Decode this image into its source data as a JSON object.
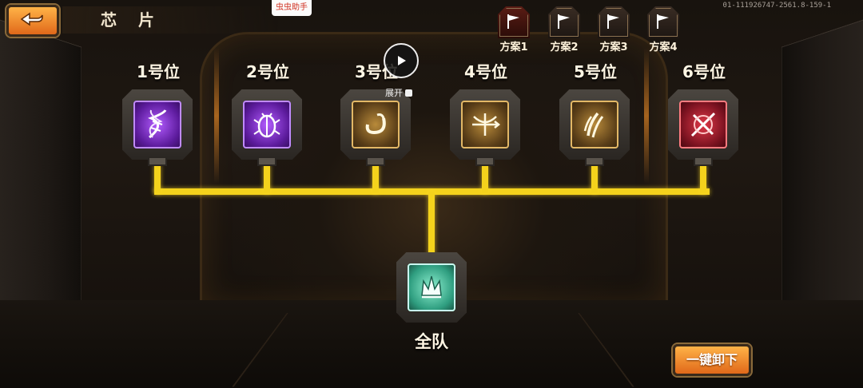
{
  "header": {
    "title": "芯 片",
    "helper_tag": "虫虫助手",
    "build_id": "01-111926747-2561.8-159-1"
  },
  "plans": [
    {
      "label": "方案1",
      "active": true
    },
    {
      "label": "方案2",
      "active": false
    },
    {
      "label": "方案3",
      "active": false
    },
    {
      "label": "方案4",
      "active": false
    }
  ],
  "slots": [
    {
      "label": "1号位",
      "icon": "dna-icon",
      "rarity_color": "purple"
    },
    {
      "label": "2号位",
      "icon": "beetle-icon",
      "rarity_color": "purple"
    },
    {
      "label": "3号位",
      "icon": "swirl-icon",
      "rarity_color": "gold"
    },
    {
      "label": "4号位",
      "icon": "crossbow-icon",
      "rarity_color": "gold"
    },
    {
      "label": "5号位",
      "icon": "claw-slash-icon",
      "rarity_color": "gold"
    },
    {
      "label": "6号位",
      "icon": "crossed-blades-icon",
      "rarity_color": "red"
    }
  ],
  "team_slot": {
    "label": "全队",
    "icon": "crown-icon",
    "rarity_color": "green"
  },
  "overlay": {
    "expand_label": "展开"
  },
  "actions": {
    "unequip_all": "一键卸下"
  },
  "colors": {
    "accent_orange": "#e0681a",
    "connector_yellow": "#f4d21c",
    "purple": "#5c1b9c",
    "gold": "#b88a3a",
    "red": "#7a1220",
    "green": "#2f9e80"
  }
}
